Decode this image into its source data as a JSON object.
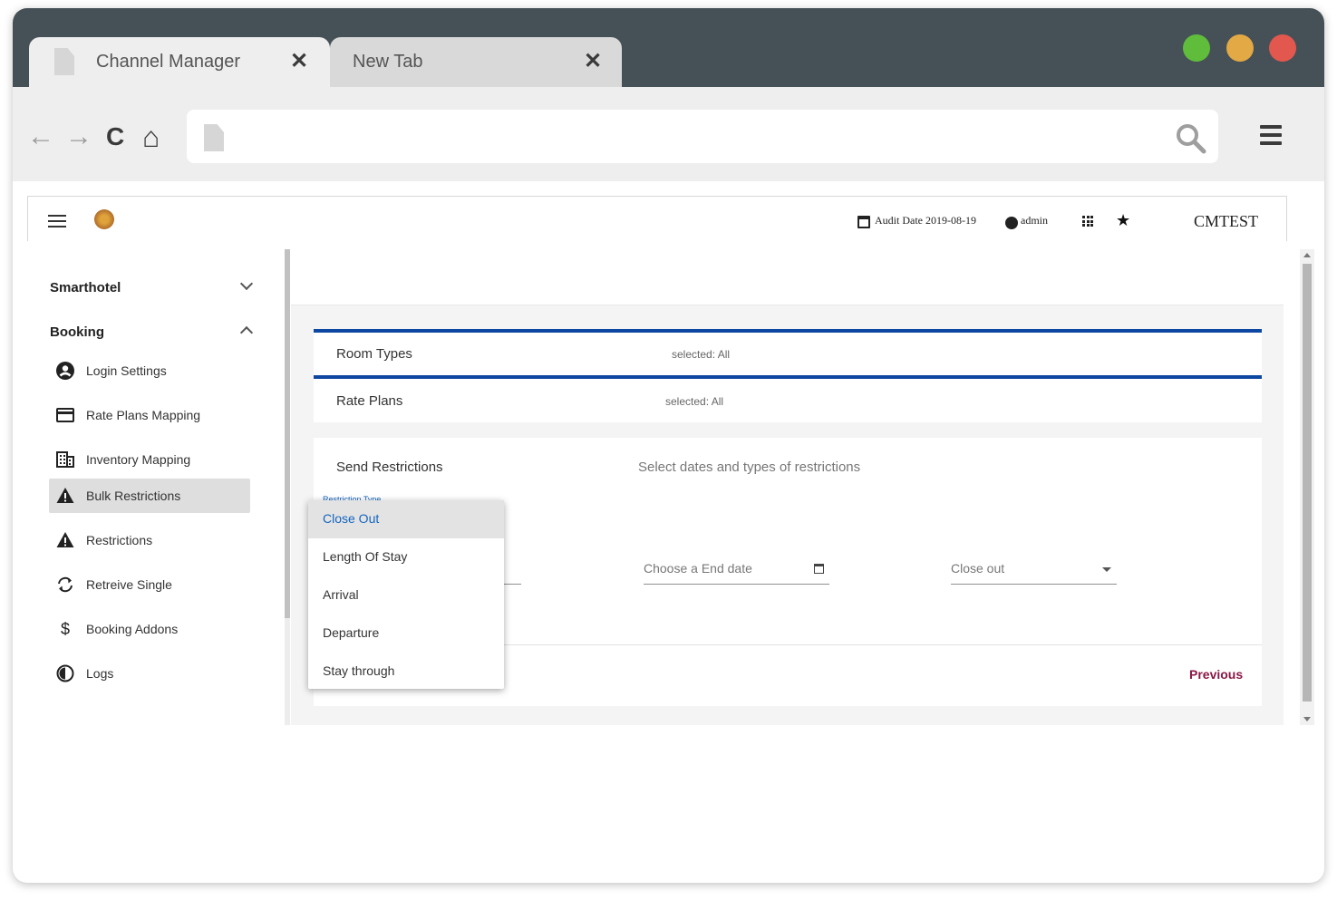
{
  "browser": {
    "tabs": [
      {
        "title": "Channel Manager",
        "close": "✕"
      },
      {
        "title": "New Tab",
        "close": "✕"
      }
    ],
    "nav": {
      "back": "←",
      "forward": "→",
      "reload": "C",
      "home": "⌂"
    },
    "url": ""
  },
  "app": {
    "header": {
      "audit_date": "Audit Date 2019-08-19",
      "user": "admin",
      "brand": "CMTEST"
    },
    "sidebar": {
      "groups": [
        {
          "label": "Smarthotel"
        },
        {
          "label": "Booking"
        }
      ],
      "items": [
        {
          "label": "Login Settings",
          "icon": "account-circle-icon"
        },
        {
          "label": "Rate Plans Mapping",
          "icon": "credit-card-icon"
        },
        {
          "label": "Inventory Mapping",
          "icon": "building-icon"
        },
        {
          "label": "Bulk Restrictions",
          "icon": "warning-icon"
        },
        {
          "label": "Restrictions",
          "icon": "warning-icon"
        },
        {
          "label": "Retreive Single",
          "icon": "sync-icon"
        },
        {
          "label": "Booking Addons",
          "icon": "dollar-icon"
        },
        {
          "label": "Logs",
          "icon": "clock-icon"
        }
      ]
    },
    "main": {
      "room_types": {
        "title": "Room Types",
        "selected": "selected: All"
      },
      "rate_plans": {
        "title": "Rate Plans",
        "selected": "selected: All"
      },
      "restrictions": {
        "title": "Send Restrictions",
        "description": "Select dates and types of restrictions",
        "restriction_type_label": "Restriction Type",
        "end_date_placeholder": "Choose a End date",
        "type_value": "Close out",
        "previous": "Previous"
      },
      "dropdown": {
        "options": [
          "Close Out",
          "Length Of Stay",
          "Arrival",
          "Departure",
          "Stay through"
        ],
        "selected": "Close Out"
      }
    }
  },
  "colors": {
    "accent": "#0d47a1",
    "previous": "#8a1845",
    "titlebar": "#465157"
  }
}
